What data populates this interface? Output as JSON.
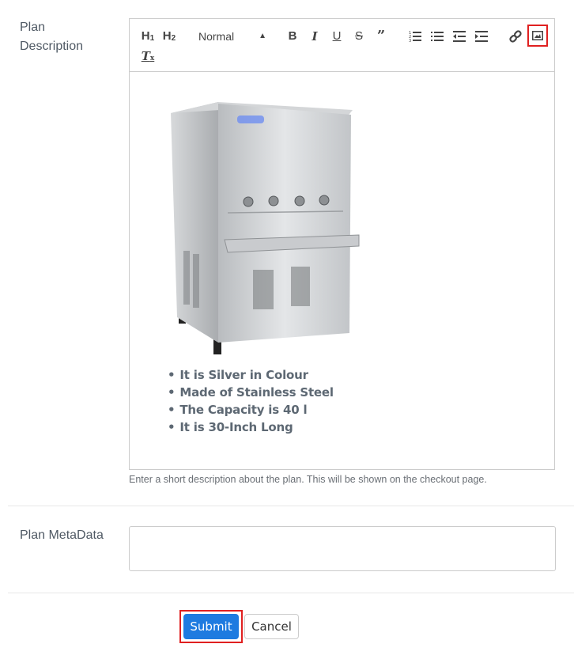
{
  "form": {
    "plan_description": {
      "label": "Plan Description",
      "toolbar": {
        "h1": "H",
        "h1_sub": "1",
        "h2": "H",
        "h2_sub": "2",
        "format_select": "Normal",
        "bold": "B",
        "italic": "I",
        "underline": "U",
        "strike": "S",
        "quote": "99",
        "clear_format": "T",
        "icons": [
          "ordered-list-icon",
          "bullet-list-icon",
          "outdent-icon",
          "indent-icon",
          "link-icon",
          "image-icon"
        ],
        "highlighted_button": "image"
      },
      "content": {
        "image_alt": "Stainless steel water cooler with four taps",
        "bullets": [
          "It is Silver in Colour",
          "Made of Stainless Steel",
          "The Capacity is 40 l",
          "It is 30-Inch Long"
        ]
      },
      "help_text": "Enter a short description about the plan. This will be shown on the checkout page."
    },
    "plan_metadata": {
      "label": "Plan MetaData",
      "value": "",
      "placeholder": ""
    },
    "buttons": {
      "submit": "Submit",
      "cancel": "Cancel"
    }
  },
  "colors": {
    "primary": "#1e7be0",
    "highlight": "#e02020",
    "border": "#cccccc",
    "label": "#4f5964"
  }
}
